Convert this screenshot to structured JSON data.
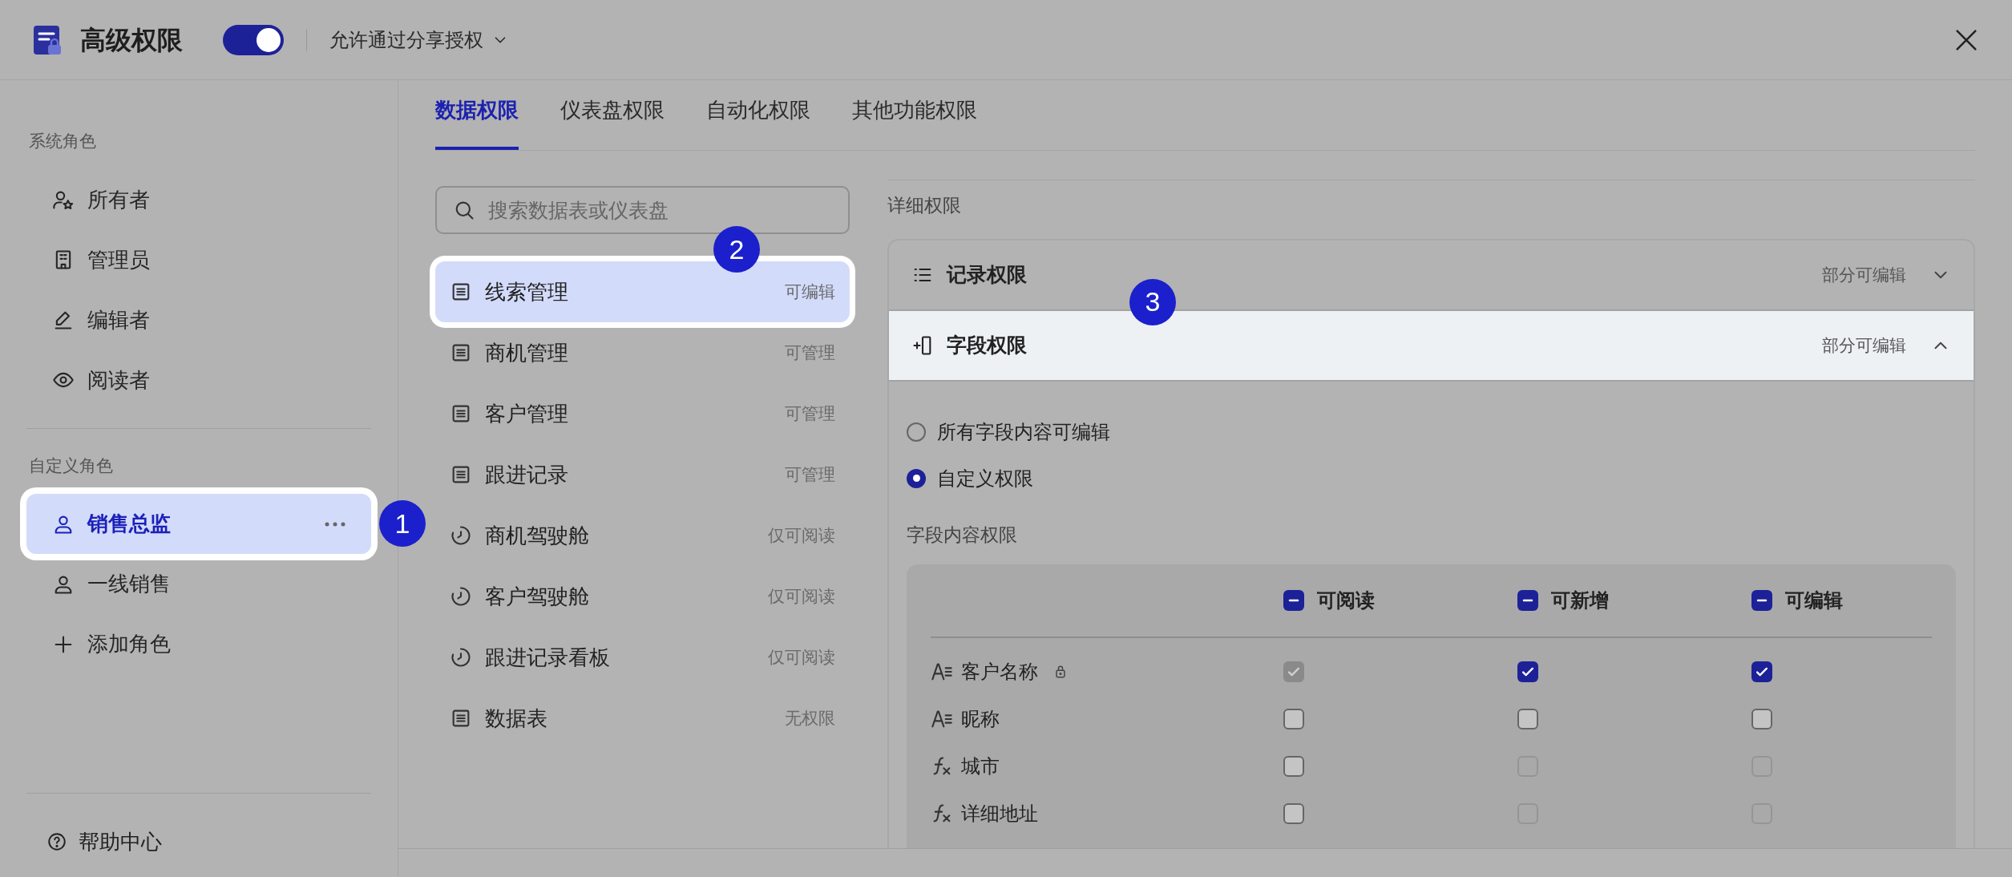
{
  "header": {
    "title": "高级权限",
    "enabled": true,
    "share_option": "允许通过分享授权"
  },
  "sidebar": {
    "groups": [
      {
        "label": "系统角色",
        "items": [
          {
            "kind": "owner",
            "label": "所有者",
            "selected": false
          },
          {
            "kind": "admin",
            "label": "管理员",
            "selected": false
          },
          {
            "kind": "editor",
            "label": "编辑者",
            "selected": false
          },
          {
            "kind": "reader",
            "label": "阅读者",
            "selected": false
          }
        ]
      },
      {
        "label": "自定义角色",
        "items": [
          {
            "kind": "custom",
            "label": "销售总监",
            "selected": true,
            "callout": "1"
          },
          {
            "kind": "custom",
            "label": "一线销售",
            "selected": false
          },
          {
            "kind": "add",
            "label": "添加角色",
            "selected": false
          }
        ]
      }
    ],
    "help": "帮助中心"
  },
  "tabs": [
    {
      "label": "数据权限",
      "selected": true
    },
    {
      "label": "仪表盘权限",
      "selected": false
    },
    {
      "label": "自动化权限",
      "selected": false
    },
    {
      "label": "其他功能权限",
      "selected": false
    }
  ],
  "search": {
    "placeholder": "搜索数据表或仪表盘"
  },
  "resources": [
    {
      "kind": "table",
      "name": "线索管理",
      "permission": "可编辑",
      "selected": true,
      "callout": "2"
    },
    {
      "kind": "table",
      "name": "商机管理",
      "permission": "可管理",
      "selected": false
    },
    {
      "kind": "table",
      "name": "客户管理",
      "permission": "可管理",
      "selected": false
    },
    {
      "kind": "table",
      "name": "跟进记录",
      "permission": "可管理",
      "selected": false
    },
    {
      "kind": "dashboard",
      "name": "商机驾驶舱",
      "permission": "仅可阅读",
      "selected": false
    },
    {
      "kind": "dashboard",
      "name": "客户驾驶舱",
      "permission": "仅可阅读",
      "selected": false
    },
    {
      "kind": "dashboard",
      "name": "跟进记录看板",
      "permission": "仅可阅读",
      "selected": false
    },
    {
      "kind": "table",
      "name": "数据表",
      "permission": "无权限",
      "selected": false
    }
  ],
  "detail": {
    "title": "详细权限",
    "sections": [
      {
        "kind": "records",
        "title": "记录权限",
        "status": "部分可编辑",
        "expanded": false,
        "highlighted": false
      },
      {
        "kind": "fields",
        "title": "字段权限",
        "status": "部分可编辑",
        "expanded": true,
        "highlighted": true,
        "callout": "3"
      }
    ],
    "options": [
      {
        "label": "所有字段内容可编辑",
        "selected": false
      },
      {
        "label": "自定义权限",
        "selected": true
      }
    ],
    "field_table": {
      "title": "字段内容权限",
      "columns": [
        {
          "label": "可阅读",
          "partial": true
        },
        {
          "label": "可新增",
          "partial": true
        },
        {
          "label": "可编辑",
          "partial": true
        }
      ],
      "rows": [
        {
          "kind": "text",
          "name": "客户名称",
          "locked": true,
          "cells": [
            {
              "checked": true,
              "disabled": true
            },
            {
              "checked": true,
              "disabled": false
            },
            {
              "checked": true,
              "disabled": false
            }
          ]
        },
        {
          "kind": "text",
          "name": "昵称",
          "locked": false,
          "cells": [
            {
              "checked": false,
              "disabled": false
            },
            {
              "checked": false,
              "disabled": false
            },
            {
              "checked": false,
              "disabled": false
            }
          ]
        },
        {
          "kind": "formula",
          "name": "城市",
          "locked": false,
          "cells": [
            {
              "checked": false,
              "disabled": false
            },
            {
              "checked": false,
              "disabled": true
            },
            {
              "checked": false,
              "disabled": true
            }
          ]
        },
        {
          "kind": "formula",
          "name": "详细地址",
          "locked": false,
          "cells": [
            {
              "checked": false,
              "disabled": false
            },
            {
              "checked": false,
              "disabled": true
            },
            {
              "checked": false,
              "disabled": true
            }
          ]
        }
      ]
    }
  }
}
